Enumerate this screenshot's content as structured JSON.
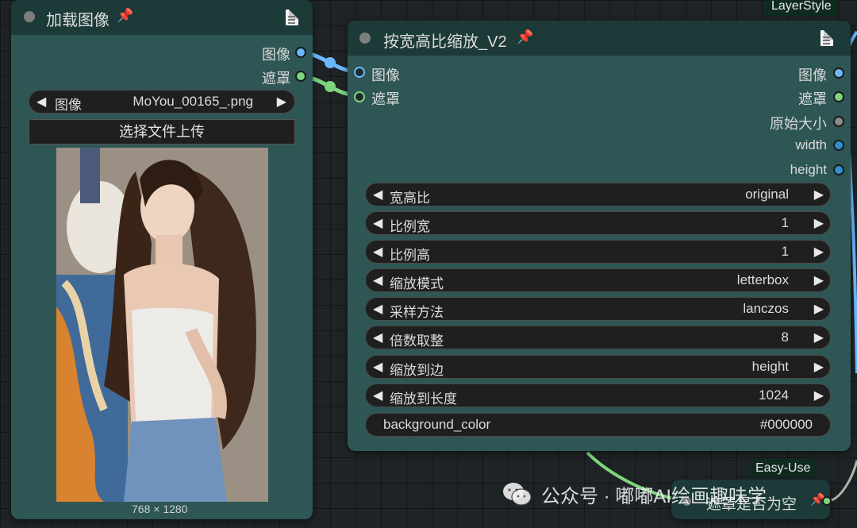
{
  "load_image_node": {
    "title": "加载图像",
    "outputs": [
      {
        "label": "图像",
        "color": "#6ab8ff"
      },
      {
        "label": "遮罩",
        "color": "#7ed47e"
      }
    ],
    "image_selector": {
      "label": "图像",
      "value": "MoYou_00165_.png"
    },
    "upload_button": "选择文件上传",
    "image_size": "768 × 1280"
  },
  "scale_node": {
    "title": "按宽高比缩放_V2",
    "inputs": [
      {
        "label": "图像",
        "color": "#6ab8ff"
      },
      {
        "label": "遮罩",
        "color": "#7ed47e"
      }
    ],
    "outputs": [
      {
        "label": "图像",
        "color": "#6ab8ff"
      },
      {
        "label": "遮罩",
        "color": "#7ed47e"
      },
      {
        "label": "原始大小",
        "color": "#8a8a8a"
      },
      {
        "label": "width",
        "color": "#2f8ed0"
      },
      {
        "label": "height",
        "color": "#2f8ed0"
      }
    ],
    "widgets": [
      {
        "label": "宽高比",
        "value": "original"
      },
      {
        "label": "比例宽",
        "value": "1"
      },
      {
        "label": "比例高",
        "value": "1"
      },
      {
        "label": "缩放模式",
        "value": "letterbox"
      },
      {
        "label": "采样方法",
        "value": "lanczos"
      },
      {
        "label": "倍数取整",
        "value": "8"
      },
      {
        "label": "缩放到边",
        "value": "height"
      },
      {
        "label": "缩放到长度",
        "value": "1024"
      }
    ],
    "background_color": {
      "label": "background_color",
      "value": "#000000"
    }
  },
  "badges": {
    "layerstyle": "LayerStyle",
    "easyuse": "Easy-Use"
  },
  "bottom_node": {
    "title": "遮罩是否为空"
  },
  "watermark": "公众号 · 嘟嘟AI绘画趣味学",
  "colors": {
    "node_body": "#2e5654",
    "node_header": "#1b3a38",
    "link_blue": "#6ab8ff",
    "link_green": "#7ed47e",
    "pin": "#e0303a"
  }
}
